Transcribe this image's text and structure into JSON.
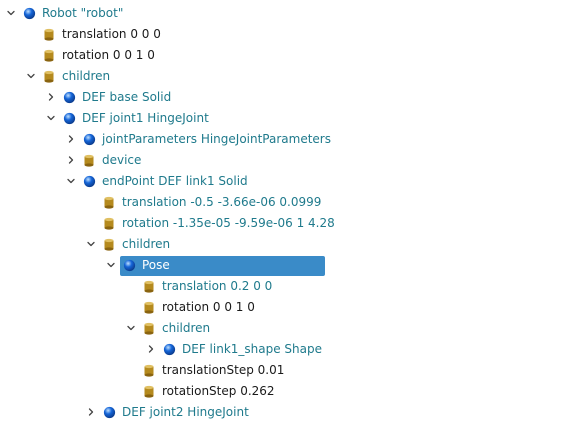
{
  "scene_tree": {
    "rows": [
      {
        "label": "Robot \"robot\"",
        "type": "node",
        "expander": "expanded",
        "depth": 0
      },
      {
        "label": "translation 0 0 0",
        "type": "field",
        "expander": "none",
        "depth": 1
      },
      {
        "label": "rotation 0 0 1 0",
        "type": "field",
        "expander": "none",
        "depth": 1
      },
      {
        "label": "children",
        "type": "field-node",
        "expander": "expanded",
        "depth": 1
      },
      {
        "label": "DEF base Solid",
        "type": "node",
        "expander": "collapsed",
        "depth": 2
      },
      {
        "label": "DEF joint1 HingeJoint",
        "type": "node",
        "expander": "expanded",
        "depth": 2
      },
      {
        "label": "jointParameters HingeJointParameters",
        "type": "node",
        "expander": "collapsed",
        "depth": 3
      },
      {
        "label": "device",
        "type": "field-node",
        "expander": "collapsed",
        "depth": 3
      },
      {
        "label": "endPoint DEF link1 Solid",
        "type": "node",
        "expander": "expanded",
        "depth": 3
      },
      {
        "label": "translation -0.5 -3.66e-06 0.0999",
        "type": "field-node",
        "expander": "none",
        "depth": 4
      },
      {
        "label": "rotation -1.35e-05 -9.59e-06 1 4.28",
        "type": "field-node",
        "expander": "none",
        "depth": 4
      },
      {
        "label": "children",
        "type": "field-node",
        "expander": "expanded",
        "depth": 4
      },
      {
        "label": "Pose",
        "type": "node",
        "expander": "expanded",
        "depth": 5,
        "selected": true
      },
      {
        "label": "translation 0.2 0 0",
        "type": "field-node",
        "expander": "none",
        "depth": 6
      },
      {
        "label": "rotation 0 0 1 0",
        "type": "field",
        "expander": "none",
        "depth": 6
      },
      {
        "label": "children",
        "type": "field-node",
        "expander": "expanded",
        "depth": 6
      },
      {
        "label": "DEF link1_shape Shape",
        "type": "node",
        "expander": "collapsed",
        "depth": 7
      },
      {
        "label": "translationStep 0.01",
        "type": "field",
        "expander": "none",
        "depth": 6
      },
      {
        "label": "rotationStep 0.262",
        "type": "field",
        "expander": "none",
        "depth": 6
      },
      {
        "label": "DEF joint2 HingeJoint",
        "type": "node",
        "expander": "collapsed",
        "depth": 4
      }
    ]
  },
  "colors": {
    "node_text": "#1f7a8c",
    "field_text": "#1a1a1a",
    "selection_bg": "#3a8bc8",
    "node_icon": "#1565d8",
    "field_icon": "#b58a1e"
  },
  "icons": {
    "node": "blue-sphere-icon",
    "field": "gold-cylinder-icon",
    "expanded": "chevron-down-icon",
    "collapsed": "chevron-right-icon"
  }
}
